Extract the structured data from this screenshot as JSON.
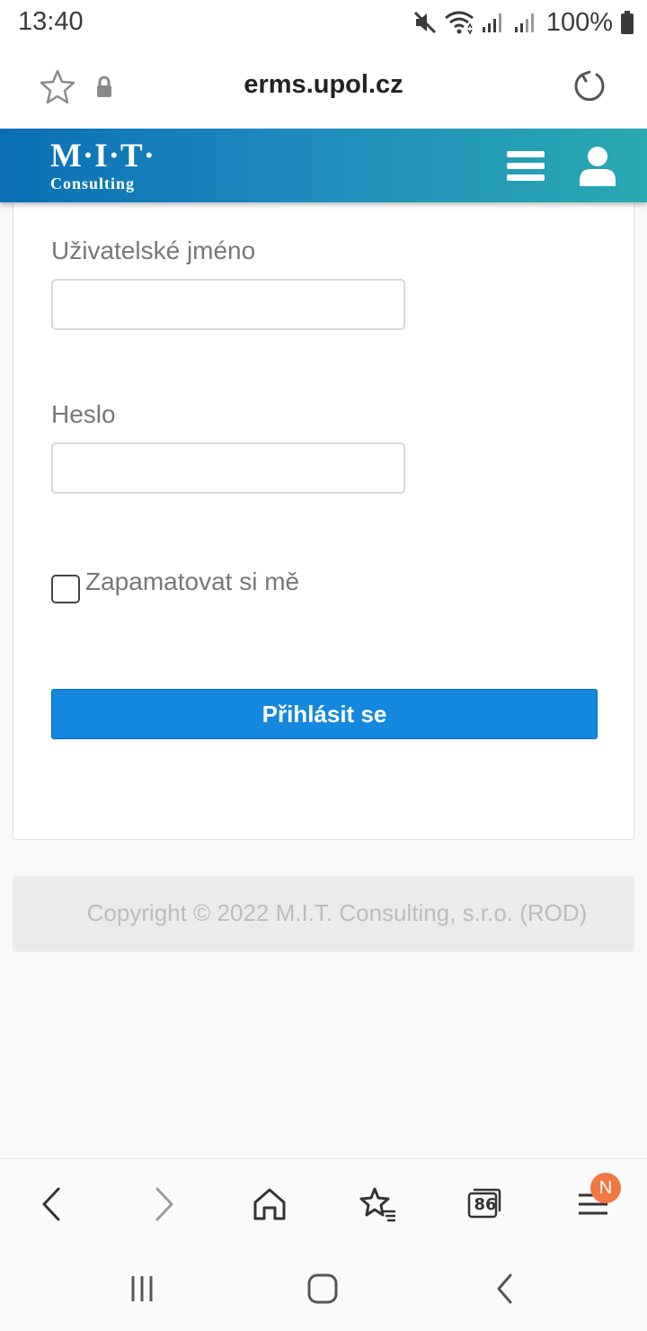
{
  "status_bar": {
    "time": "13:40",
    "battery": "100%",
    "icons": [
      "mute-icon",
      "wifi-icon",
      "signal-icon",
      "signal-icon",
      "battery-icon"
    ]
  },
  "browser": {
    "url": "erms.upol.cz",
    "icons": [
      "bookmark-star-icon",
      "lock-icon",
      "reload-icon"
    ]
  },
  "site_header": {
    "logo_main": "M·I·T·",
    "logo_sub": "Consulting",
    "accent_colors": [
      "#0a6fb5",
      "#2aa9b1"
    ],
    "icons": [
      "menu-icon",
      "user-icon"
    ]
  },
  "login_form": {
    "username_label": "Uživatelské jméno",
    "username_value": "",
    "password_label": "Heslo",
    "password_value": "",
    "remember_label": "Zapamatovat si mě",
    "remember_checked": false,
    "submit_label": "Přihlásit se",
    "submit_color": "#1487de"
  },
  "footer": {
    "copyright": "Copyright © 2022 M.I.T. Consulting, s.r.o. (ROD)"
  },
  "bottom_toolbar": {
    "tabs_count": "86",
    "menu_badge": "N",
    "icons": [
      "back-icon",
      "forward-icon",
      "home-icon",
      "bookmarks-icon",
      "tabs-icon",
      "menu-icon"
    ]
  },
  "nav_bar": {
    "icons": [
      "recent-apps-icon",
      "home-icon",
      "back-icon"
    ]
  }
}
